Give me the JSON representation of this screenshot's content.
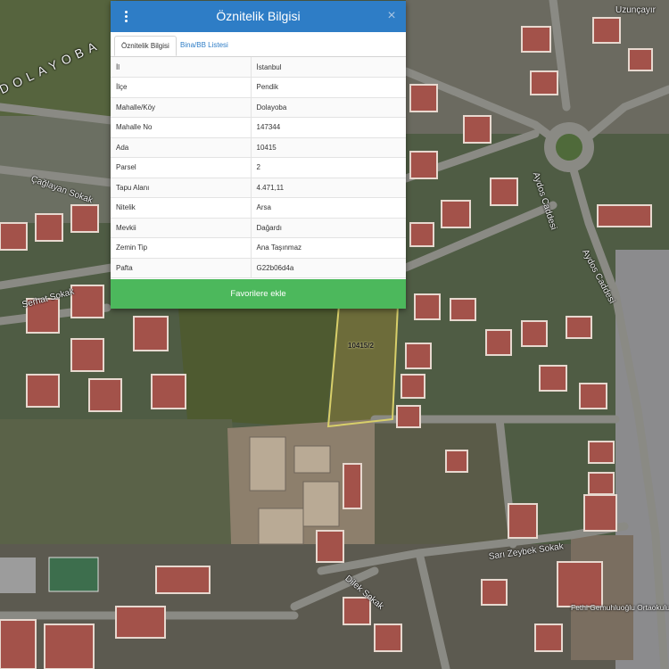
{
  "panel": {
    "title": "Öznitelik Bilgisi",
    "tabs": [
      {
        "label": "Öznitelik Bilgisi",
        "active": true
      },
      {
        "label": "Bina/BB Listesi",
        "active": false
      }
    ],
    "rows": [
      {
        "key": "İl",
        "value": "İstanbul"
      },
      {
        "key": "İlçe",
        "value": "Pendik"
      },
      {
        "key": "Mahalle/Köy",
        "value": "Dolayoba"
      },
      {
        "key": "Mahalle No",
        "value": "147344"
      },
      {
        "key": "Ada",
        "value": "10415"
      },
      {
        "key": "Parsel",
        "value": "2"
      },
      {
        "key": "Tapu Alanı",
        "value": "4.471,11"
      },
      {
        "key": "Nitelik",
        "value": "Arsa"
      },
      {
        "key": "Mevkii",
        "value": "Dağardı"
      },
      {
        "key": "Zemin Tip",
        "value": "Ana Taşınmaz"
      },
      {
        "key": "Pafta",
        "value": "G22b06d4a"
      }
    ],
    "favorite_label": "Favorilere ekle"
  },
  "map": {
    "parcel_label": "10415/2",
    "streets": [
      "Çağlayan Sokak",
      "Serhat Sokak",
      "Aydos Caddesi",
      "Aydos Caddesi",
      "Sarı Zeybek Sokak",
      "Dilek Sokak",
      "Uzunçayır",
      "Fethi Gemuhluoğlu Ortaokulu",
      "DOLAYOBA"
    ]
  },
  "colors": {
    "header": "#2e7dc6",
    "favorite": "#4cb85c",
    "parcel_outline": "#d8cf6a"
  }
}
